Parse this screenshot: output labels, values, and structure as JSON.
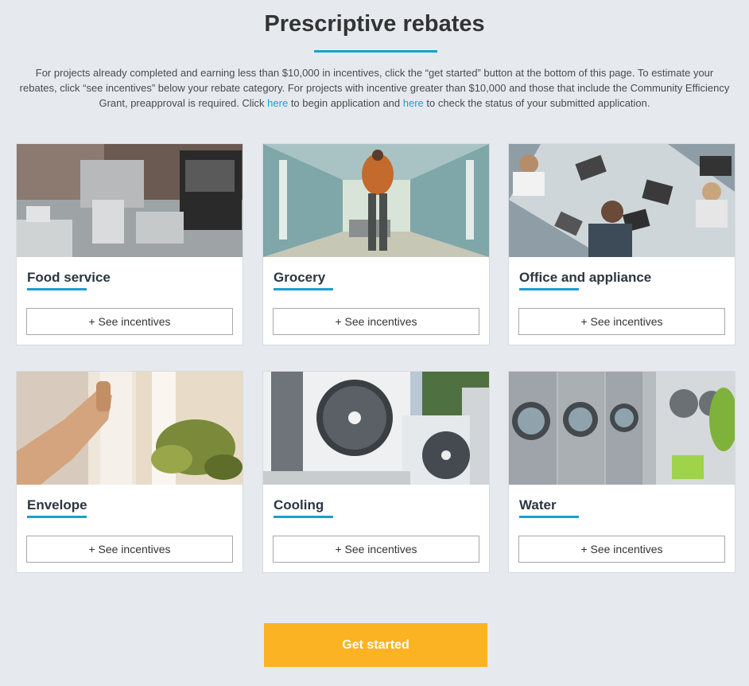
{
  "header": {
    "title": "Prescriptive rebates"
  },
  "intro": {
    "text_1": "For projects already completed and earning less than $10,000 in incentives, click the “get started” button at the bottom of this page. To estimate your rebates, click “see incentives” below your rebate category. For projects with incentive greater than $10,000 and those that include the Community Efficiency Grant, preapproval is required. Click ",
    "link_1": "here",
    "text_2": " to begin application and ",
    "link_2": "here",
    "text_3": " to check the status of your submitted application."
  },
  "categories": [
    {
      "title": "Food service",
      "button": "+ See incentives",
      "image": "commercial-kitchen-photo"
    },
    {
      "title": "Grocery",
      "button": "+ See incentives",
      "image": "grocery-aisle-photo"
    },
    {
      "title": "Office and appliance",
      "button": "+ See incentives",
      "image": "office-meeting-photo"
    },
    {
      "title": "Envelope",
      "button": "+ See incentives",
      "image": "window-hand-photo"
    },
    {
      "title": "Cooling",
      "button": "+ See incentives",
      "image": "ac-units-photo"
    },
    {
      "title": "Water",
      "button": "+ See incentives",
      "image": "washing-machines-photo"
    }
  ],
  "footer": {
    "get_started_label": "Get started"
  },
  "colors": {
    "background": "#e6eaef",
    "accent": "#1a9fd0",
    "cta": "#fbb324"
  }
}
